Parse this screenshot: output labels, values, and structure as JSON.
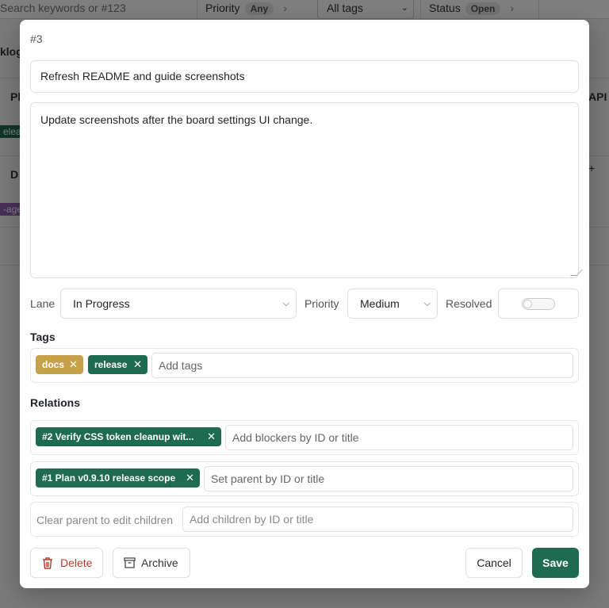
{
  "background": {
    "search_placeholder": "Search keywords or #123",
    "priority_label": "Priority",
    "priority_value": "Any",
    "tags_select": "All tags",
    "status_label": "Status",
    "status_value": "Open",
    "frag_backlog": "klog",
    "frag_pl": "Pl",
    "frag_d": "D",
    "frag_api": "API",
    "frag_release": "eleas",
    "frag_age": "-age",
    "frag_plus": "+"
  },
  "modal": {
    "id_label": "#3",
    "title_value": "Refresh README and guide screenshots",
    "description_value": "Update screenshots after the board settings UI change.",
    "lane_label": "Lane",
    "lane_value": "In Progress",
    "priority_label": "Priority",
    "priority_value": "Medium",
    "resolved_label": "Resolved",
    "resolved_value": false,
    "tags_heading": "Tags",
    "tags": [
      {
        "label": "docs",
        "color": "#c9a04a"
      },
      {
        "label": "release",
        "color": "#1f6b52"
      }
    ],
    "tags_placeholder": "Add tags",
    "relations_heading": "Relations",
    "blocker_chip": "#2 Verify CSS token cleanup wit...",
    "blockers_placeholder": "Add blockers by ID or title",
    "parent_chip": "#1 Plan v0.9.10 release scope",
    "parent_placeholder": "Set parent by ID or title",
    "children_note": "Clear parent to edit children",
    "children_placeholder": "Add children by ID or title",
    "delete_label": "Delete",
    "archive_label": "Archive",
    "cancel_label": "Cancel",
    "save_label": "Save"
  },
  "colors": {
    "accent": "#1f6b52",
    "danger": "#c0392b",
    "tag_docs": "#c9a04a"
  }
}
